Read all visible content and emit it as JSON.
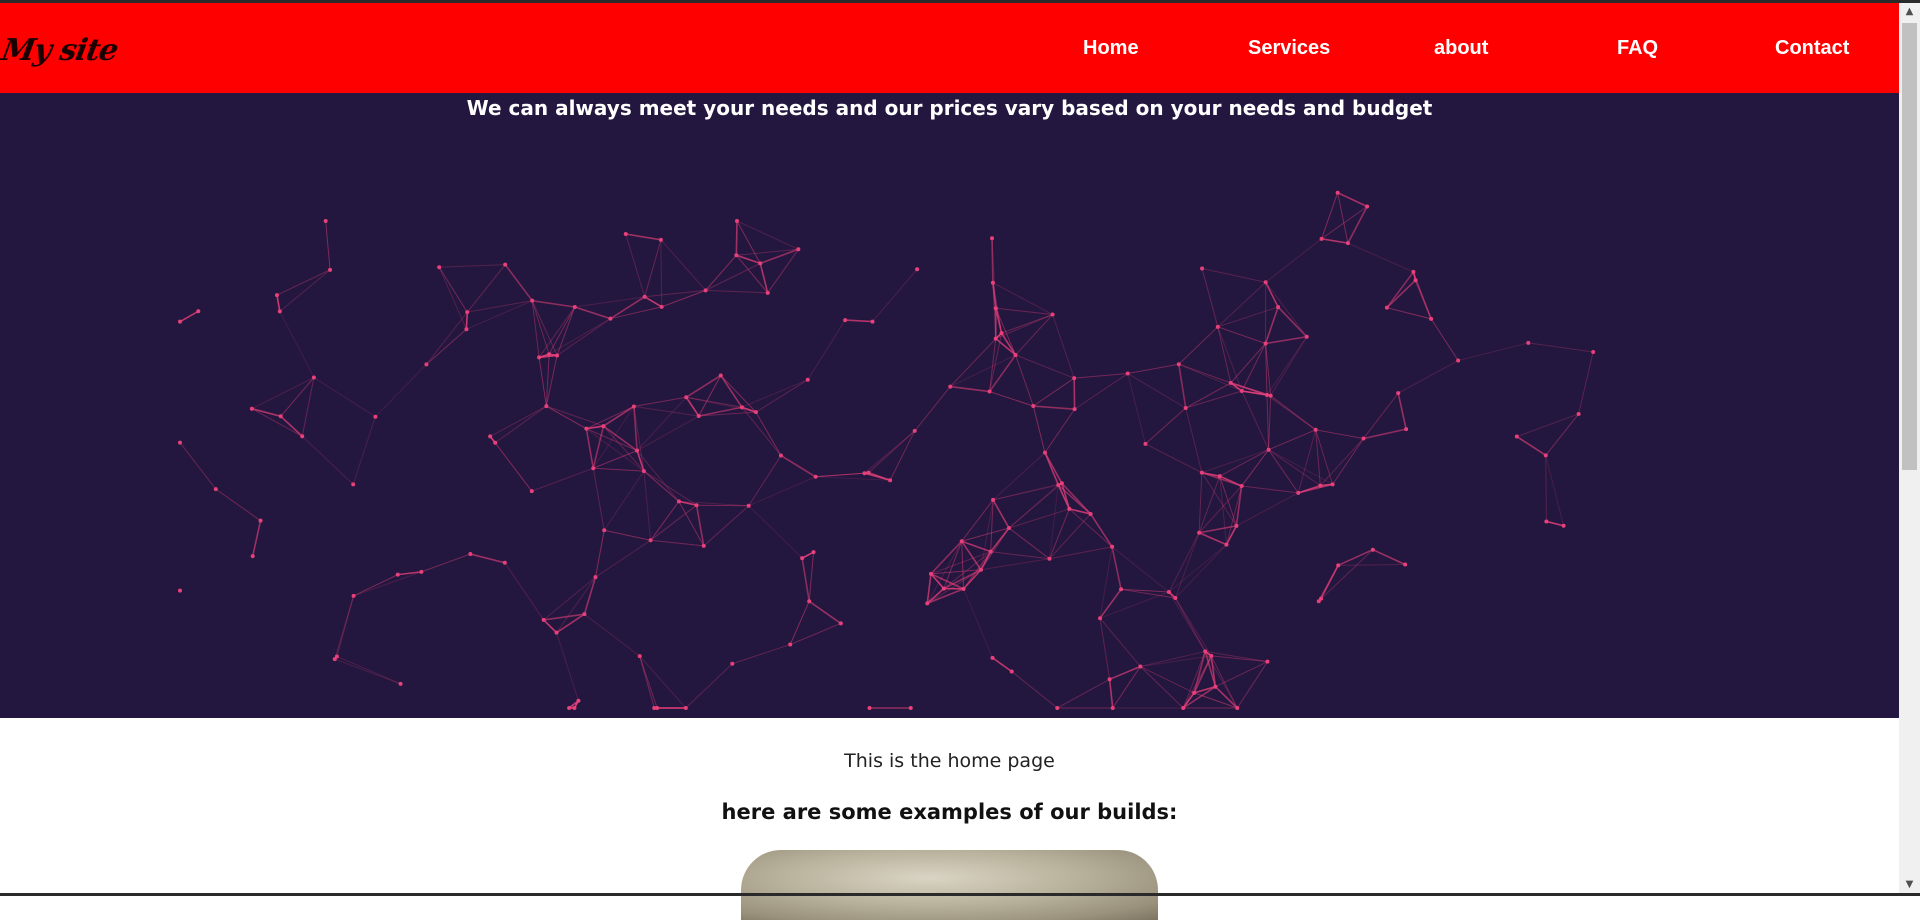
{
  "header": {
    "logo": "My site",
    "nav": [
      "Home",
      "Services",
      "about",
      "FAQ",
      "Contact"
    ]
  },
  "hero": {
    "tagline": "We can always meet your needs and our prices vary based on your needs and budget"
  },
  "main": {
    "intro": "This is the home page",
    "examples_heading": "here are some examples of our builds:"
  },
  "colors": {
    "navbar": "#ff0000",
    "hero_background": "#23173f",
    "network_lines": "#e8407a"
  },
  "icons": {
    "scroll_up": "chevron-up-icon",
    "scroll_down": "chevron-down-icon"
  }
}
